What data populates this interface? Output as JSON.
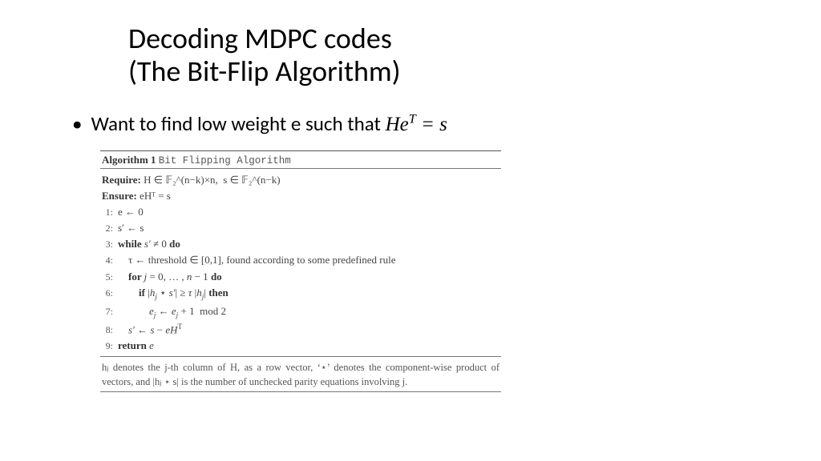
{
  "title_line1": "Decoding MDPC codes",
  "title_line2": "(The Bit-Flip Algorithm)",
  "bullet": {
    "lead": "Want to find low weight e such that ",
    "eq_lhs": "He",
    "eq_sup": "T",
    "eq_mid": " = ",
    "eq_rhs": "s"
  },
  "algorithm": {
    "label": "Algorithm 1",
    "name": "Bit Flipping Algorithm",
    "require_kw": "Require:",
    "require_body": " H ∈ 𝔽₂^(n−k)×n,  s ∈ 𝔽₂^(n−k)",
    "ensure_kw": "Ensure:",
    "ensure_body": " eHᵀ = s",
    "lines": [
      "e ← 0",
      "s′ ← s",
      "while s′ ≠ 0 do",
      "    τ ← threshold ∈ [0,1], found according to some predefined rule",
      "    for j = 0, … , n − 1 do",
      "        if |hⱼ ⋆ s′| ≥ τ |hⱼ| then",
      "            eⱼ ← eⱼ + 1  mod 2",
      "    s′ ← s − eHᵀ",
      "return e"
    ],
    "footnote": "hⱼ denotes the j-th column of H, as a row vector, ‘⋆’ denotes the component-wise product of vectors, and |hⱼ ⋆ s| is the number of unchecked parity equations involving j."
  }
}
